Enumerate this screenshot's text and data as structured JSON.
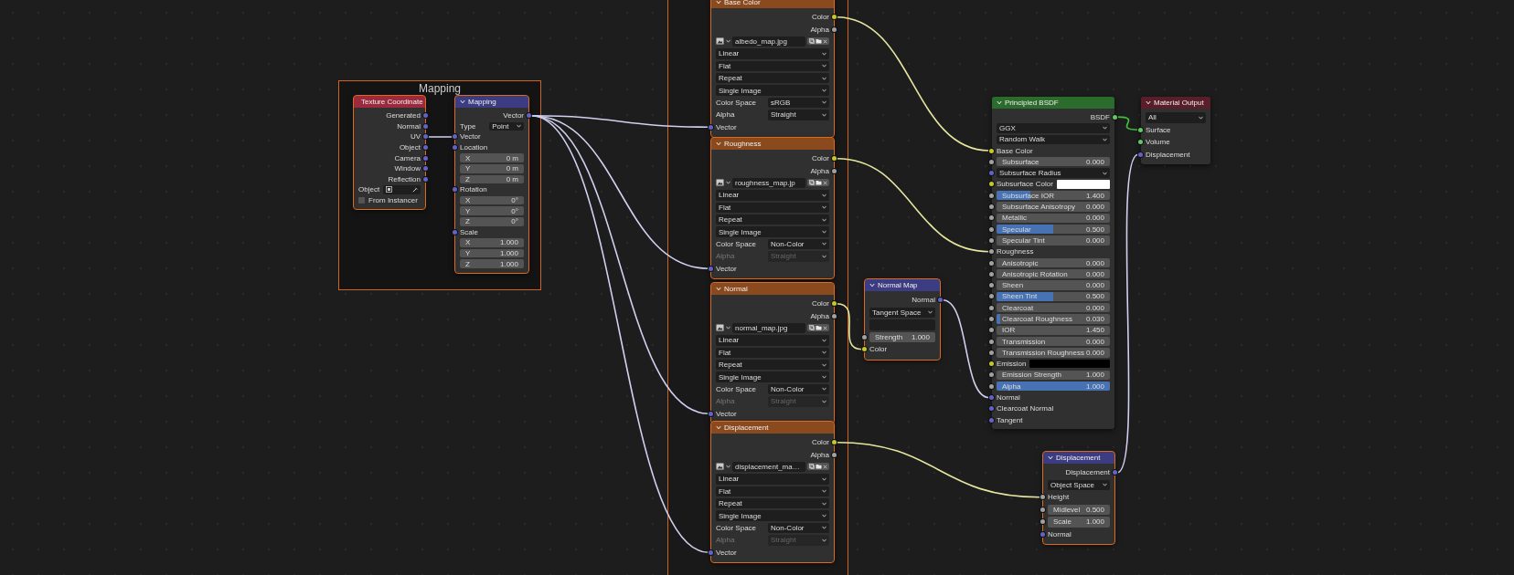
{
  "frames": [
    {
      "label": "Mapping"
    }
  ],
  "nodes": [
    {
      "title": "Texture Coordinate",
      "color": "#9b2a3e",
      "selected": true,
      "rows": [
        {
          "kind": "output",
          "label": "Generated",
          "color": "#6363c7"
        },
        {
          "kind": "output",
          "label": "Normal",
          "color": "#6363c7"
        },
        {
          "kind": "output",
          "label": "UV",
          "color": "#6363c7"
        },
        {
          "kind": "output",
          "label": "Object",
          "color": "#6363c7"
        },
        {
          "kind": "output",
          "label": "Camera",
          "color": "#6363c7"
        },
        {
          "kind": "output",
          "label": "Window",
          "color": "#6363c7"
        },
        {
          "kind": "output",
          "label": "Reflection",
          "color": "#6363c7"
        },
        {
          "kind": "object",
          "label": "Object"
        },
        {
          "kind": "checkbox",
          "label": "From Instancer",
          "checked": false
        }
      ]
    },
    {
      "title": "Mapping",
      "color": "#3c3c83",
      "selected": true,
      "rows": [
        {
          "kind": "output",
          "label": "Vector",
          "color": "#6363c7"
        },
        {
          "kind": "labeled-select",
          "label": "Type",
          "value": "Point",
          "disabled": false
        },
        {
          "kind": "input",
          "label": "Vector",
          "color": "#6363c7"
        },
        {
          "kind": "input",
          "label": "Location",
          "color": "#6363c7"
        },
        {
          "kind": "number",
          "label": "X",
          "value": "0 m"
        },
        {
          "kind": "number",
          "label": "Y",
          "value": "0 m"
        },
        {
          "kind": "number",
          "label": "Z",
          "value": "0 m"
        },
        {
          "kind": "input",
          "label": "Rotation",
          "color": "#6363c7"
        },
        {
          "kind": "number",
          "label": "X",
          "value": "0°"
        },
        {
          "kind": "number",
          "label": "Y",
          "value": "0°"
        },
        {
          "kind": "number",
          "label": "Z",
          "value": "0°"
        },
        {
          "kind": "input",
          "label": "Scale",
          "color": "#6363c7"
        },
        {
          "kind": "number",
          "label": "X",
          "value": "1.000"
        },
        {
          "kind": "number",
          "label": "Y",
          "value": "1.000"
        },
        {
          "kind": "number",
          "label": "Z",
          "value": "1.000"
        }
      ]
    },
    {
      "title": "Base Color",
      "color": "#8a4a1e",
      "selected": true,
      "rows": [
        {
          "kind": "output",
          "label": "Color",
          "color": "#c7c729"
        },
        {
          "kind": "output",
          "label": "Alpha",
          "color": "#a1a1a1"
        },
        {
          "kind": "image",
          "value": "albedo_map.jpg"
        },
        {
          "kind": "select",
          "value": "Linear"
        },
        {
          "kind": "select",
          "value": "Flat"
        },
        {
          "kind": "select",
          "value": "Repeat"
        },
        {
          "kind": "select",
          "value": "Single Image"
        },
        {
          "kind": "labeled-select",
          "label": "Color Space",
          "value": "sRGB",
          "disabled": false
        },
        {
          "kind": "labeled-select",
          "label": "Alpha",
          "value": "Straight",
          "disabled": false
        },
        {
          "kind": "input",
          "label": "Vector",
          "color": "#6363c7"
        }
      ]
    },
    {
      "title": "Roughness",
      "color": "#8a4a1e",
      "selected": true,
      "rows": [
        {
          "kind": "output",
          "label": "Color",
          "color": "#c7c729"
        },
        {
          "kind": "output",
          "label": "Alpha",
          "color": "#a1a1a1"
        },
        {
          "kind": "image",
          "value": "roughness_map.jp"
        },
        {
          "kind": "select",
          "value": "Linear"
        },
        {
          "kind": "select",
          "value": "Flat"
        },
        {
          "kind": "select",
          "value": "Repeat"
        },
        {
          "kind": "select",
          "value": "Single Image"
        },
        {
          "kind": "labeled-select",
          "label": "Color Space",
          "value": "Non-Color",
          "disabled": false
        },
        {
          "kind": "labeled-select",
          "label": "Alpha",
          "value": "Straight",
          "disabled": true
        },
        {
          "kind": "input",
          "label": "Vector",
          "color": "#6363c7"
        }
      ]
    },
    {
      "title": "Normal",
      "color": "#8a4a1e",
      "selected": true,
      "rows": [
        {
          "kind": "output",
          "label": "Color",
          "color": "#c7c729"
        },
        {
          "kind": "output",
          "label": "Alpha",
          "color": "#a1a1a1"
        },
        {
          "kind": "image",
          "value": "normal_map.jpg"
        },
        {
          "kind": "select",
          "value": "Linear"
        },
        {
          "kind": "select",
          "value": "Flat"
        },
        {
          "kind": "select",
          "value": "Repeat"
        },
        {
          "kind": "select",
          "value": "Single Image"
        },
        {
          "kind": "labeled-select",
          "label": "Color Space",
          "value": "Non-Color",
          "disabled": false
        },
        {
          "kind": "labeled-select",
          "label": "Alpha",
          "value": "Straight",
          "disabled": true
        },
        {
          "kind": "input",
          "label": "Vector",
          "color": "#6363c7"
        }
      ]
    },
    {
      "title": "Displacement",
      "color": "#8a4a1e",
      "selected": true,
      "rows": [
        {
          "kind": "output",
          "label": "Color",
          "color": "#c7c729"
        },
        {
          "kind": "output",
          "label": "Alpha",
          "color": "#a1a1a1"
        },
        {
          "kind": "image",
          "value": "displacement_ma…"
        },
        {
          "kind": "select",
          "value": "Linear"
        },
        {
          "kind": "select",
          "value": "Flat"
        },
        {
          "kind": "select",
          "value": "Repeat"
        },
        {
          "kind": "select",
          "value": "Single Image"
        },
        {
          "kind": "labeled-select",
          "label": "Color Space",
          "value": "Non-Color",
          "disabled": false
        },
        {
          "kind": "labeled-select",
          "label": "Alpha",
          "value": "Straight",
          "disabled": true
        },
        {
          "kind": "input",
          "label": "Vector",
          "color": "#6363c7"
        }
      ]
    },
    {
      "title": "Normal Map",
      "color": "#3c3c83",
      "selected": true,
      "rows": [
        {
          "kind": "output",
          "label": "Normal",
          "color": "#6363c7"
        },
        {
          "kind": "select",
          "value": "Tangent Space"
        },
        {
          "kind": "field"
        },
        {
          "kind": "slider",
          "label": "Strength",
          "value": "1.000",
          "level": 0,
          "color": "#a1a1a1"
        },
        {
          "kind": "input",
          "label": "Color",
          "color": "#c7c729"
        }
      ]
    },
    {
      "title": "Principled BSDF",
      "color": "#2b6b2b",
      "selected": false,
      "rows": [
        {
          "kind": "output",
          "label": "BSDF",
          "color": "#63c763"
        },
        {
          "kind": "select",
          "value": "GGX"
        },
        {
          "kind": "select",
          "value": "Random Walk"
        },
        {
          "kind": "input",
          "label": "Base Color",
          "color": "#c7c729"
        },
        {
          "kind": "slider",
          "label": "Subsurface",
          "value": "0.000",
          "level": 0,
          "color": "#a1a1a1"
        },
        {
          "kind": "select",
          "value": "Subsurface Radius",
          "color": "#6363c7"
        },
        {
          "kind": "swatch",
          "label": "Subsurface Color",
          "color": "#ffffff"
        },
        {
          "kind": "slider",
          "label": "Subsurface IOR",
          "value": "1.400",
          "level": 0.3,
          "color": "#a1a1a1"
        },
        {
          "kind": "slider",
          "label": "Subsurface Anisotropy",
          "value": "0.000",
          "level": 0,
          "color": "#a1a1a1"
        },
        {
          "kind": "slider",
          "label": "Metallic",
          "value": "0.000",
          "level": 0,
          "color": "#a1a1a1"
        },
        {
          "kind": "slider",
          "label": "Specular",
          "value": "0.500",
          "level": 0.5,
          "color": "#a1a1a1"
        },
        {
          "kind": "slider",
          "label": "Specular Tint",
          "value": "0.000",
          "level": 0,
          "color": "#a1a1a1"
        },
        {
          "kind": "input",
          "label": "Roughness",
          "color": "#a1a1a1"
        },
        {
          "kind": "slider",
          "label": "Anisotropic",
          "value": "0.000",
          "level": 0,
          "color": "#a1a1a1"
        },
        {
          "kind": "slider",
          "label": "Anisotropic Rotation",
          "value": "0.000",
          "level": 0,
          "color": "#a1a1a1"
        },
        {
          "kind": "slider",
          "label": "Sheen",
          "value": "0.000",
          "level": 0,
          "color": "#a1a1a1"
        },
        {
          "kind": "slider",
          "label": "Sheen Tint",
          "value": "0.500",
          "level": 0.5,
          "color": "#a1a1a1"
        },
        {
          "kind": "slider",
          "label": "Clearcoat",
          "value": "0.000",
          "level": 0,
          "color": "#a1a1a1"
        },
        {
          "kind": "slider",
          "label": "Clearcoat Roughness",
          "value": "0.030",
          "level": 0.03,
          "color": "#a1a1a1"
        },
        {
          "kind": "slider",
          "label": "IOR",
          "value": "1.450",
          "level": 0,
          "color": "#a1a1a1"
        },
        {
          "kind": "slider",
          "label": "Transmission",
          "value": "0.000",
          "level": 0,
          "color": "#a1a1a1"
        },
        {
          "kind": "slider",
          "label": "Transmission Roughness",
          "value": "0.000",
          "level": 0,
          "color": "#a1a1a1"
        },
        {
          "kind": "swatch",
          "label": "Emission",
          "color": "#000000"
        },
        {
          "kind": "slider",
          "label": "Emission Strength",
          "value": "1.000",
          "level": 0,
          "color": "#a1a1a1"
        },
        {
          "kind": "slider",
          "label": "Alpha",
          "value": "1.000",
          "level": 1,
          "color": "#a1a1a1"
        },
        {
          "kind": "input",
          "label": "Normal",
          "color": "#6363c7"
        },
        {
          "kind": "input",
          "label": "Clearcoat Normal",
          "color": "#6363c7"
        },
        {
          "kind": "input",
          "label": "Tangent",
          "color": "#6363c7"
        }
      ]
    },
    {
      "title": "Material Output",
      "color": "#5a1e2a",
      "selected": false,
      "rows": [
        {
          "kind": "select",
          "value": "All"
        },
        {
          "kind": "input",
          "label": "Surface",
          "color": "#63c763"
        },
        {
          "kind": "input",
          "label": "Volume",
          "color": "#63c763"
        },
        {
          "kind": "input",
          "label": "Displacement",
          "color": "#6363c7"
        }
      ]
    },
    {
      "title": "Displacement",
      "color": "#3c3c83",
      "selected": true,
      "rows": [
        {
          "kind": "output",
          "label": "Displacement",
          "color": "#6363c7"
        },
        {
          "kind": "select",
          "value": "Object Space"
        },
        {
          "kind": "input",
          "label": "Height",
          "color": "#a1a1a1"
        },
        {
          "kind": "slider",
          "label": "Midlevel",
          "value": "0.500",
          "level": 0,
          "color": "#a1a1a1"
        },
        {
          "kind": "slider",
          "label": "Scale",
          "value": "1.000",
          "level": 0,
          "color": "#a1a1a1"
        },
        {
          "kind": "input",
          "label": "Normal",
          "color": "#6363c7"
        }
      ]
    }
  ]
}
